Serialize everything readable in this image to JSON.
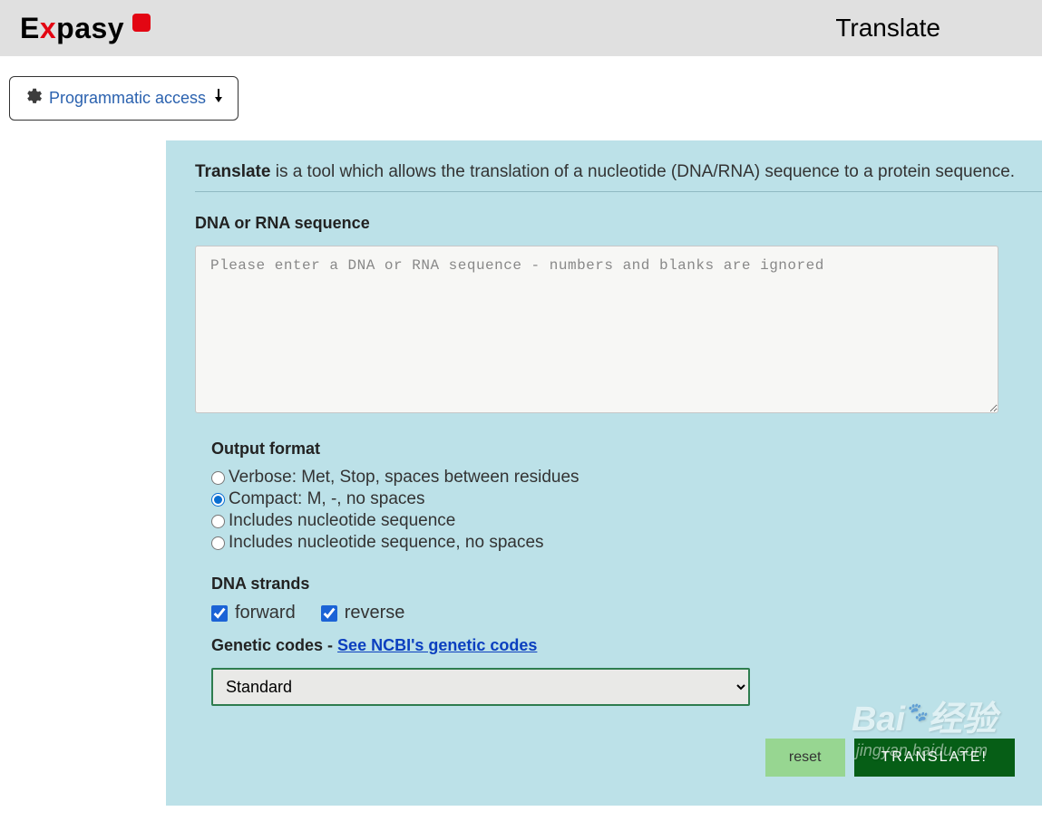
{
  "header": {
    "logo_prefix": "E",
    "logo_x": "x",
    "logo_suffix": "pasy",
    "page_title": "Translate"
  },
  "toolbar": {
    "programmatic_label": "Programmatic access"
  },
  "intro": {
    "bold": "Translate",
    "rest": " is a tool which allows the translation of a nucleotide (DNA/RNA) sequence to a protein sequence."
  },
  "form": {
    "seq_label": "DNA or RNA sequence",
    "seq_placeholder": "Please enter a DNA or RNA sequence - numbers and blanks are ignored",
    "seq_value": "",
    "output_label": "Output format",
    "output_options": {
      "verbose": "Verbose: Met, Stop, spaces between residues",
      "compact": "Compact: M, -, no spaces",
      "include": "Includes nucleotide sequence",
      "include_nospace": "Includes nucleotide sequence, no spaces"
    },
    "strands_label": "DNA strands",
    "strand_forward": "forward",
    "strand_reverse": "reverse",
    "gc_label": "Genetic codes - ",
    "gc_link": "See NCBI's genetic codes",
    "gc_selected": "Standard",
    "reset": "reset",
    "translate": "TRANSLATE!"
  },
  "watermark": {
    "logo": "Bai",
    "logo2": "经验",
    "url": "jingyan.baidu.com"
  }
}
